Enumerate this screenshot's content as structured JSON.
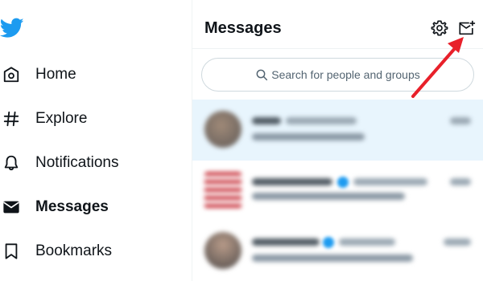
{
  "brand": {
    "logo_icon": "twitter-bird-icon",
    "color": "#1d9bf0"
  },
  "sidebar": {
    "items": [
      {
        "label": "Home",
        "icon": "home-icon",
        "active": false
      },
      {
        "label": "Explore",
        "icon": "hashtag-icon",
        "active": false
      },
      {
        "label": "Notifications",
        "icon": "bell-icon",
        "active": false
      },
      {
        "label": "Messages",
        "icon": "envelope-icon",
        "active": true
      },
      {
        "label": "Bookmarks",
        "icon": "bookmark-icon",
        "active": false
      }
    ]
  },
  "messages_panel": {
    "title": "Messages",
    "settings_icon": "gear-icon",
    "new_message_icon": "new-message-icon",
    "search": {
      "placeholder": "Search for people and groups",
      "icon": "search-icon"
    }
  },
  "annotation": {
    "type": "arrow",
    "color": "#e8202a",
    "points_to": "new-message-icon"
  },
  "colors": {
    "highlight_row": "#e8f5fd",
    "divider": "#eff3f4",
    "accent": "#1d9bf0"
  }
}
